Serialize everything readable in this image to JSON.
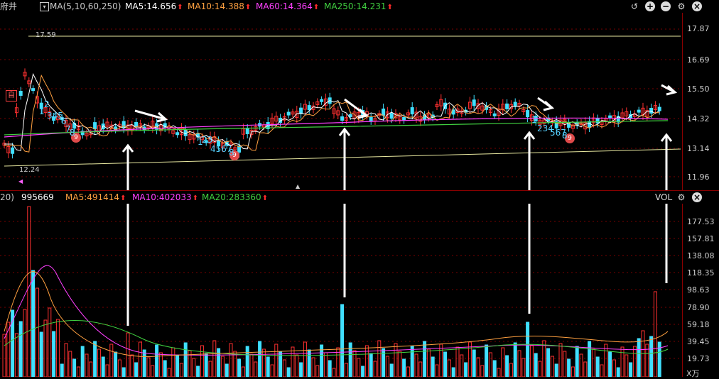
{
  "header": {
    "stock_name": "府井",
    "ma_group": "MA(5,10,60,250)",
    "ma5": "MA5:14.656",
    "ma10": "MA10:14.388",
    "ma60": "MA60:14.364",
    "ma250": "MA250:14.231"
  },
  "volume_header": {
    "period": "20)",
    "volume": "995669",
    "ma5": "MA5:491414",
    "ma10": "MA10:402033",
    "ma20": "MA20:283360",
    "indicator": "VOL"
  },
  "price_axis": [
    "17.87",
    "16.69",
    "15.50",
    "14.32",
    "13.14",
    "11.96"
  ],
  "volume_axis": [
    "177.53",
    "157.81",
    "138.08",
    "118.35",
    "98.63",
    "78.90",
    "59.18",
    "39.45",
    "19.73"
  ],
  "volume_unit": "X万",
  "annotations": {
    "high": "17.59",
    "low": "12.24",
    "badge": "自",
    "nine": "9"
  },
  "colors": {
    "ma5": "#ffffff",
    "ma10": "#ffa040",
    "ma60": "#ff40ff",
    "ma250": "#40d040",
    "up": "#ff3030",
    "down": "#40e0ff"
  },
  "icons": [
    "ma-dropdown-icon",
    "refresh-icon",
    "zoom-in-icon",
    "zoom-out-icon",
    "settings-icon",
    "close-icon"
  ]
}
